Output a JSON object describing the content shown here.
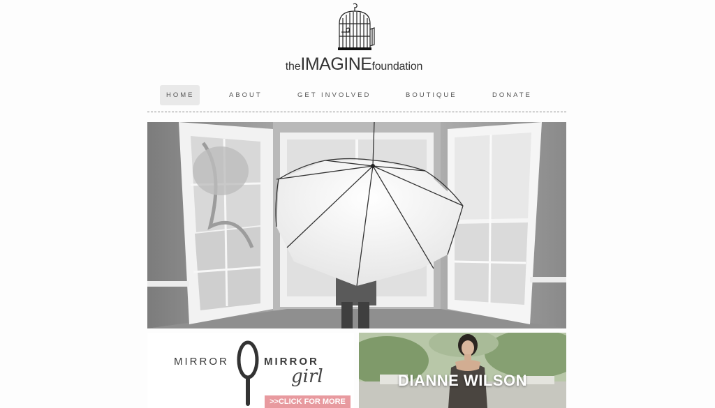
{
  "logo": {
    "prefix": "the",
    "name": "IMAGINE",
    "suffix": "foundation"
  },
  "nav": {
    "items": [
      {
        "label": "HOME",
        "active": true
      },
      {
        "label": "ABOUT",
        "active": false
      },
      {
        "label": "GET INVOLVED",
        "active": false
      },
      {
        "label": "BOUTIQUE",
        "active": false
      },
      {
        "label": "DONATE",
        "active": false
      }
    ]
  },
  "banners": {
    "mirror": {
      "word1": "MIRROR",
      "word2": "MIRROR",
      "script": "girl",
      "cta": ">>CLICK FOR MORE",
      "cta_color": "#e89a9f"
    },
    "dianne": {
      "name": "DIANNE WILSON"
    }
  }
}
